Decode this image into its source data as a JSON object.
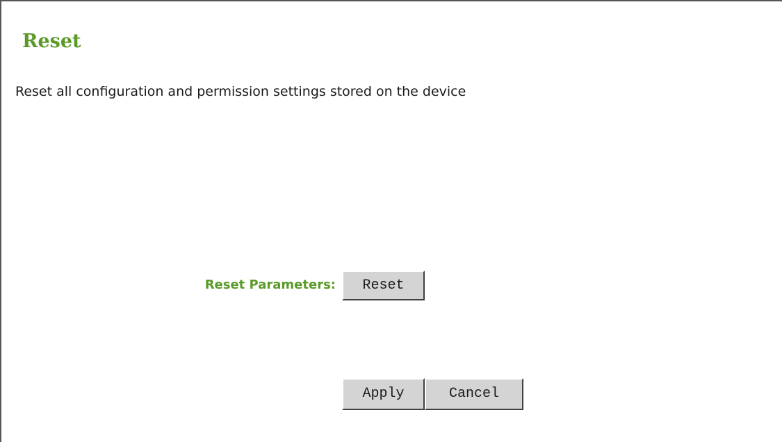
{
  "page": {
    "title": "Reset",
    "description": "Reset all configuration and permission settings stored on the device"
  },
  "form": {
    "reset_parameters_label": "Reset Parameters:",
    "reset_button_label": "Reset"
  },
  "actions": {
    "apply_label": "Apply",
    "cancel_label": "Cancel"
  },
  "colors": {
    "accent_green": "#5a9a28",
    "button_face": "#d4d4d4",
    "text": "#1a1a1a"
  }
}
